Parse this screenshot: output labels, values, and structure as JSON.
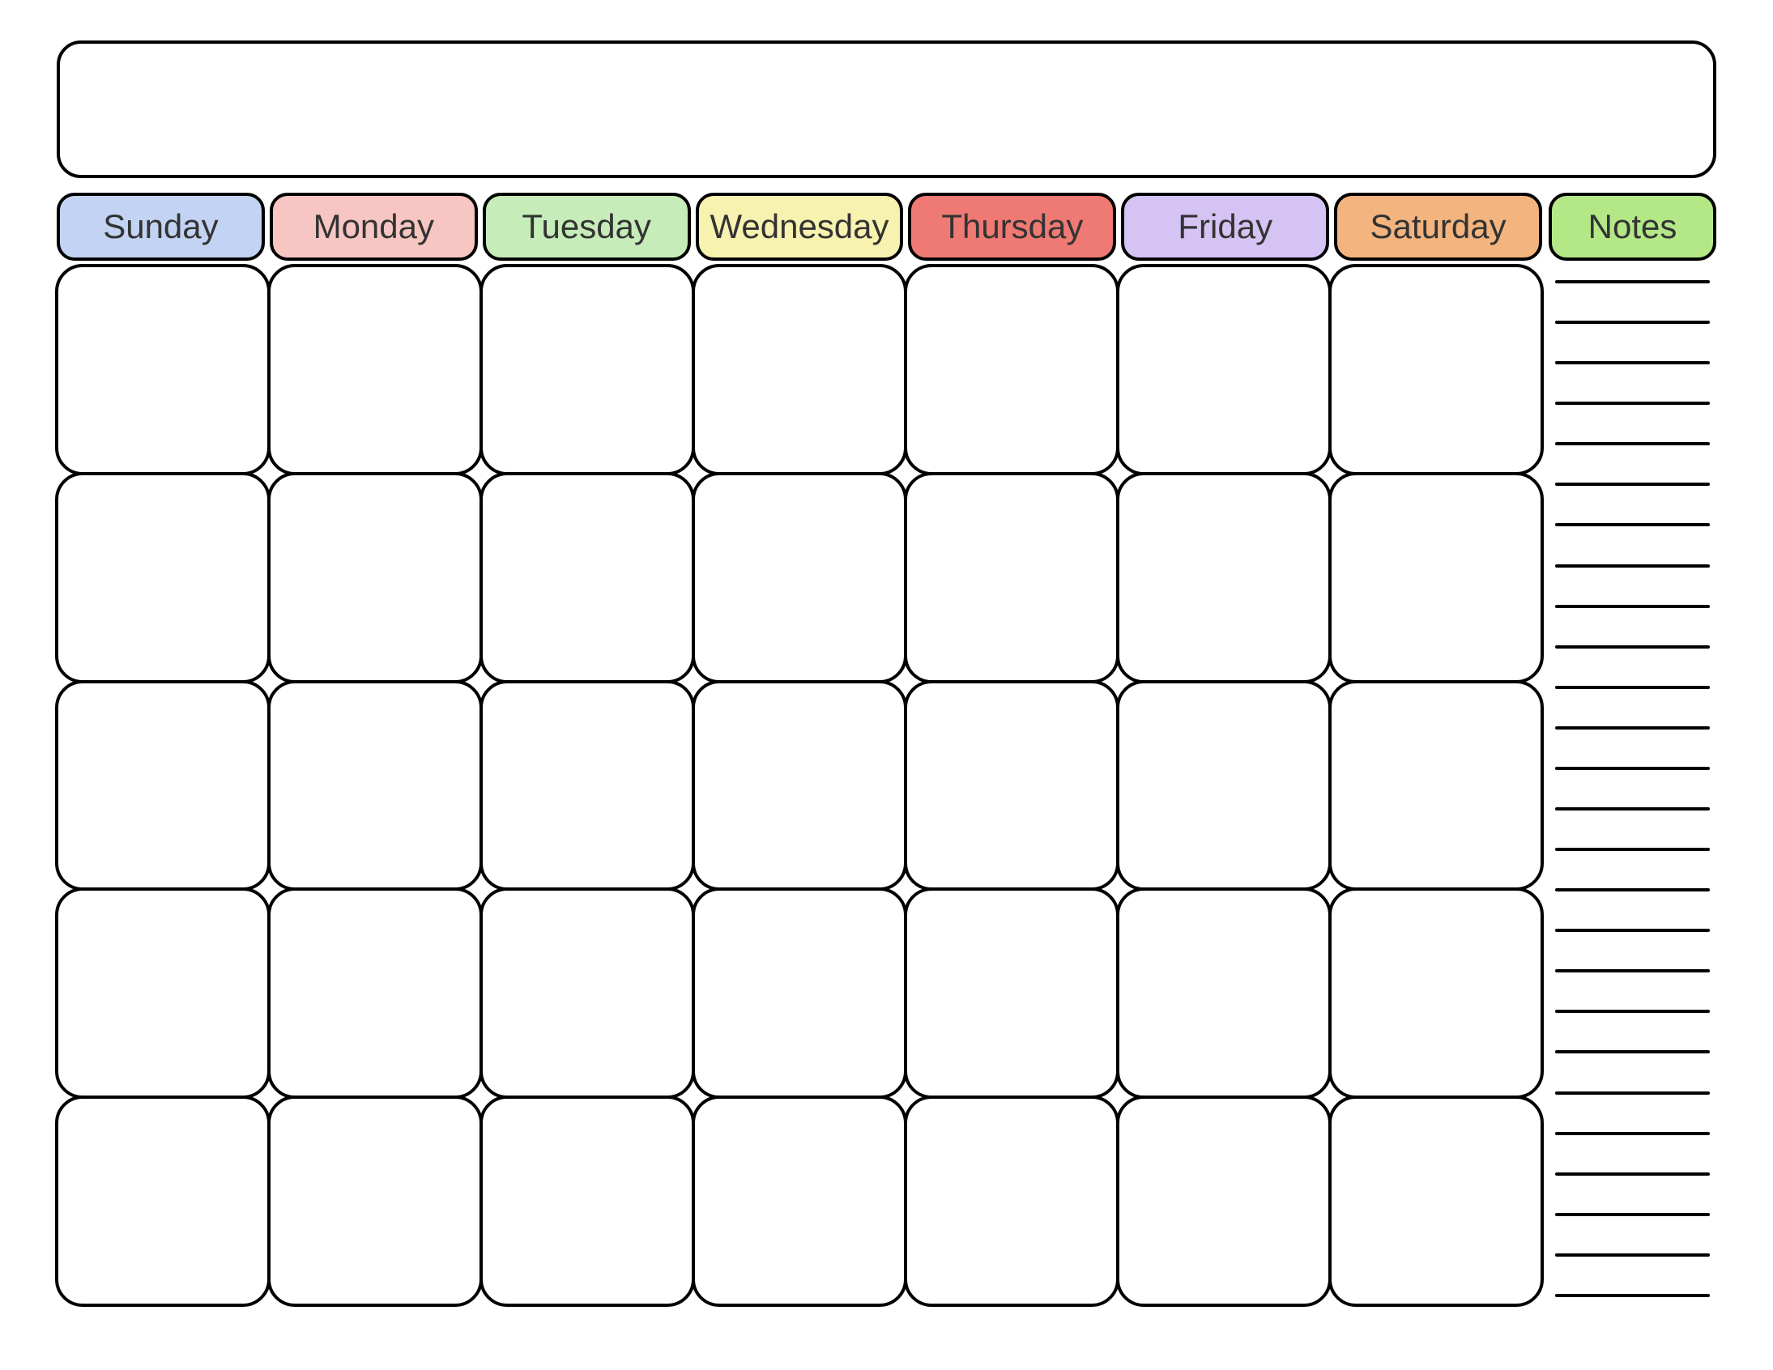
{
  "calendar": {
    "days": {
      "sunday": "Sunday",
      "monday": "Monday",
      "tuesday": "Tuesday",
      "wednesday": "Wednesday",
      "thursday": "Thursday",
      "friday": "Friday",
      "saturday": "Saturday"
    },
    "notes_label": "Notes",
    "weeks": 5,
    "note_lines": 26,
    "colors": {
      "sunday": "#c3d3f3",
      "monday": "#f7c6c2",
      "tuesday": "#c6edb9",
      "wednesday": "#f7f2b0",
      "thursday": "#ef7a73",
      "friday": "#d5c3f3",
      "saturday": "#f3b47f",
      "notes": "#b4e887"
    }
  }
}
